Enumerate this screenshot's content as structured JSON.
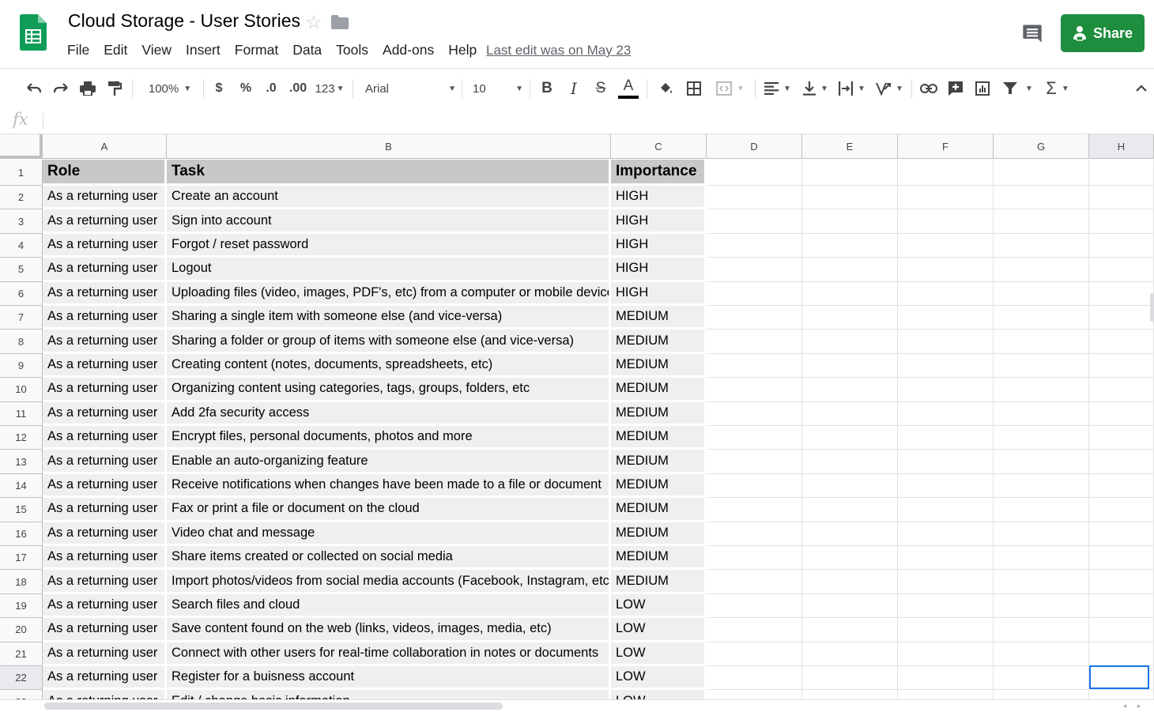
{
  "doc": {
    "title": "Cloud Storage - User Stories",
    "last_edit": "Last edit was on May 23",
    "share_label": "Share"
  },
  "menu": [
    "File",
    "Edit",
    "View",
    "Insert",
    "Format",
    "Data",
    "Tools",
    "Add-ons",
    "Help"
  ],
  "toolbar": {
    "zoom": "100%",
    "currency": "$",
    "percent": "%",
    "dec_less": ".0",
    "dec_more": ".00",
    "number_format": "123",
    "font": "Arial",
    "font_size": "10",
    "bold": "B",
    "italic": "I",
    "strike": "S",
    "text_color": "A",
    "text_color_hex": "#000000"
  },
  "formula_bar": {
    "fx": "fx",
    "value": ""
  },
  "columns": [
    "A",
    "B",
    "C",
    "D",
    "E",
    "F",
    "G",
    "H"
  ],
  "colors": {
    "share_bg": "#1e8e3e",
    "header_fill": "#c8c8c8",
    "row_fill": "#efefef",
    "selection": "#1a73e8",
    "logo": "#0f9d58"
  },
  "table": {
    "headers": [
      "Role",
      "Task",
      "Importance"
    ],
    "rows": [
      [
        "As a returning user",
        "Create an account",
        "HIGH"
      ],
      [
        "As a returning user",
        "Sign into account",
        "HIGH"
      ],
      [
        "As a returning user",
        "Forgot / reset password",
        "HIGH"
      ],
      [
        "As a returning user",
        "Logout",
        "HIGH"
      ],
      [
        "As a returning user",
        "Uploading files (video, images, PDF's, etc) from a computer or mobile device",
        "HIGH"
      ],
      [
        "As a returning user",
        "Sharing a single item with someone else (and vice-versa)",
        "MEDIUM"
      ],
      [
        "As a returning user",
        "Sharing a folder or group of items with someone else (and vice-versa)",
        "MEDIUM"
      ],
      [
        "As a returning user",
        "Creating content (notes, documents, spreadsheets, etc)",
        "MEDIUM"
      ],
      [
        "As a returning user",
        "Organizing content using categories, tags, groups, folders, etc",
        "MEDIUM"
      ],
      [
        "As a returning user",
        "Add 2fa security access",
        "MEDIUM"
      ],
      [
        "As a returning user",
        "Encrypt files, personal documents, photos and more",
        "MEDIUM"
      ],
      [
        "As a returning user",
        "Enable an auto-organizing feature",
        "MEDIUM"
      ],
      [
        "As a returning user",
        "Receive notifications when changes have been made to a file or document",
        "MEDIUM"
      ],
      [
        "As a returning user",
        "Fax or print a file or document on the cloud",
        "MEDIUM"
      ],
      [
        "As a returning user",
        "Video chat and message",
        "MEDIUM"
      ],
      [
        "As a returning user",
        "Share items created or collected on social media",
        "MEDIUM"
      ],
      [
        "As a returning user",
        "Import photos/videos from social media accounts (Facebook, Instagram, etc)",
        "MEDIUM"
      ],
      [
        "As a returning user",
        "Search files and cloud",
        "LOW"
      ],
      [
        "As a returning user",
        "Save content found on the web (links, videos, images, media, etc)",
        "LOW"
      ],
      [
        "As a returning user",
        "Connect with other users for real-time collaboration in notes or documents",
        "LOW"
      ],
      [
        "As a returning user",
        "Register for a buisness account",
        "LOW"
      ],
      [
        "As a returning user",
        "Edit / change basic information",
        "LOW"
      ]
    ]
  }
}
